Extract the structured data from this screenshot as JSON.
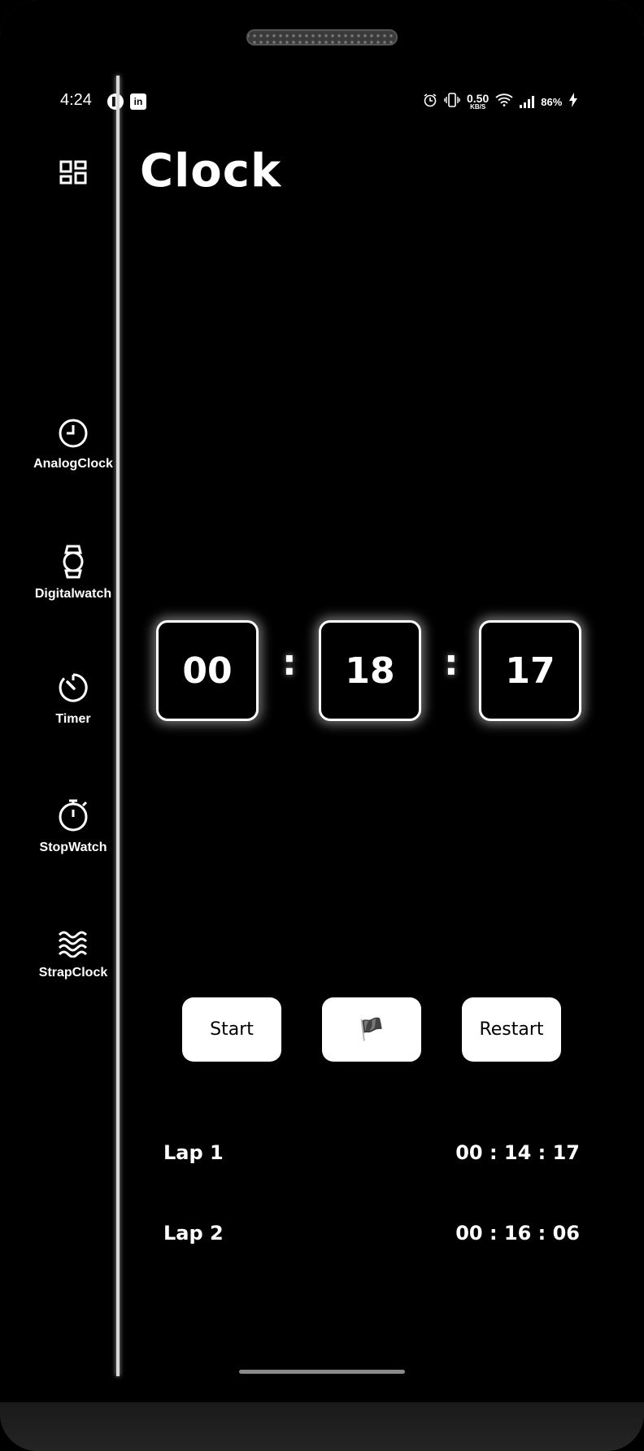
{
  "status_bar": {
    "time": "4:24",
    "net_speed": "0.50",
    "net_unit": "KB/S",
    "battery": "86%"
  },
  "app": {
    "title": "Clock"
  },
  "sidebar": {
    "items": [
      {
        "label": "AnalogClock",
        "icon": "analog-clock-icon"
      },
      {
        "label": "Digitalwatch",
        "icon": "wristwatch-icon"
      },
      {
        "label": "Timer",
        "icon": "timer-icon"
      },
      {
        "label": "StopWatch",
        "icon": "stopwatch-icon"
      },
      {
        "label": "StrapClock",
        "icon": "waves-icon"
      }
    ]
  },
  "stopwatch": {
    "hours": "00",
    "minutes": "18",
    "seconds": "17",
    "separator": ":"
  },
  "controls": {
    "start_label": "Start",
    "lap_icon": "🏴",
    "restart_label": "Restart"
  },
  "laps": [
    {
      "label": "Lap 1",
      "time": "00 : 14 : 17"
    },
    {
      "label": "Lap 2",
      "time": "00 : 16 : 06"
    }
  ]
}
